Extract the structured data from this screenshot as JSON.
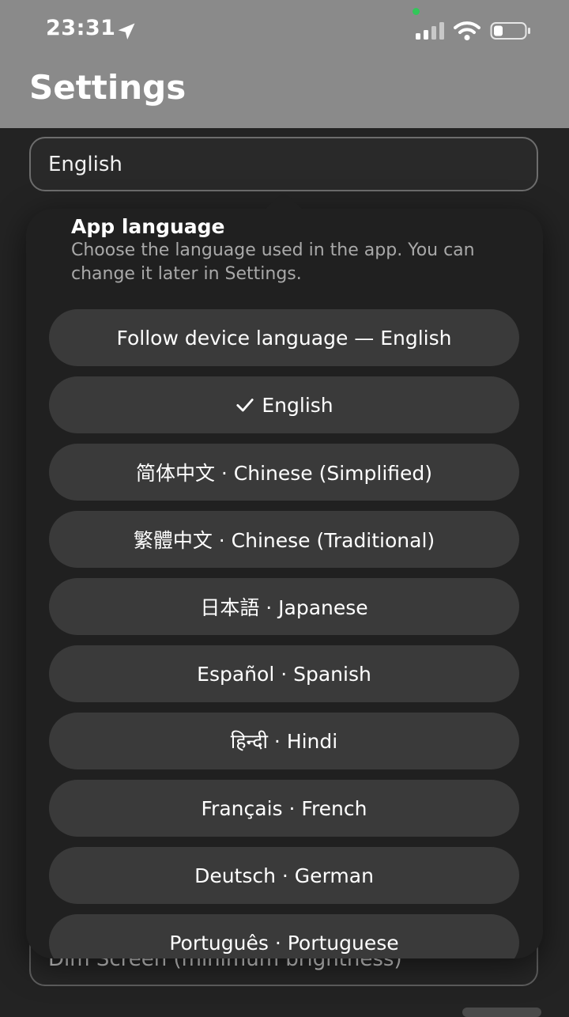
{
  "status_bar": {
    "time": "23:31",
    "icons": [
      "location-arrow-icon",
      "signal-icon",
      "wifi-icon",
      "battery-icon"
    ],
    "battery_percent": 25
  },
  "header": {
    "title": "Settings"
  },
  "settings": {
    "language_field_value": "English",
    "dim_screen_label": "Dim Screen (minimum brightness)"
  },
  "language_popover": {
    "title": "App language",
    "description": "Choose the language used in the app. You can change it later in Settings.",
    "selected_index": 1,
    "options": [
      {
        "label": "Follow device language — English",
        "selected": false
      },
      {
        "label": "English",
        "selected": true
      },
      {
        "label": "简体中文 · Chinese (Simplified)",
        "selected": false
      },
      {
        "label": "繁體中文 · Chinese (Traditional)",
        "selected": false
      },
      {
        "label": "日本語 · Japanese",
        "selected": false
      },
      {
        "label": "Español · Spanish",
        "selected": false
      },
      {
        "label": "हिन्दी · Hindi",
        "selected": false
      },
      {
        "label": "Français · French",
        "selected": false
      },
      {
        "label": "Deutsch · German",
        "selected": false
      },
      {
        "label": "Português · Portuguese",
        "selected": false
      }
    ]
  },
  "colors": {
    "header_bg": "#8a8a8a",
    "page_bg": "#232323",
    "popover_bg": "#202020",
    "option_bg": "#3a3a3a",
    "status_dot": "#31c759"
  }
}
